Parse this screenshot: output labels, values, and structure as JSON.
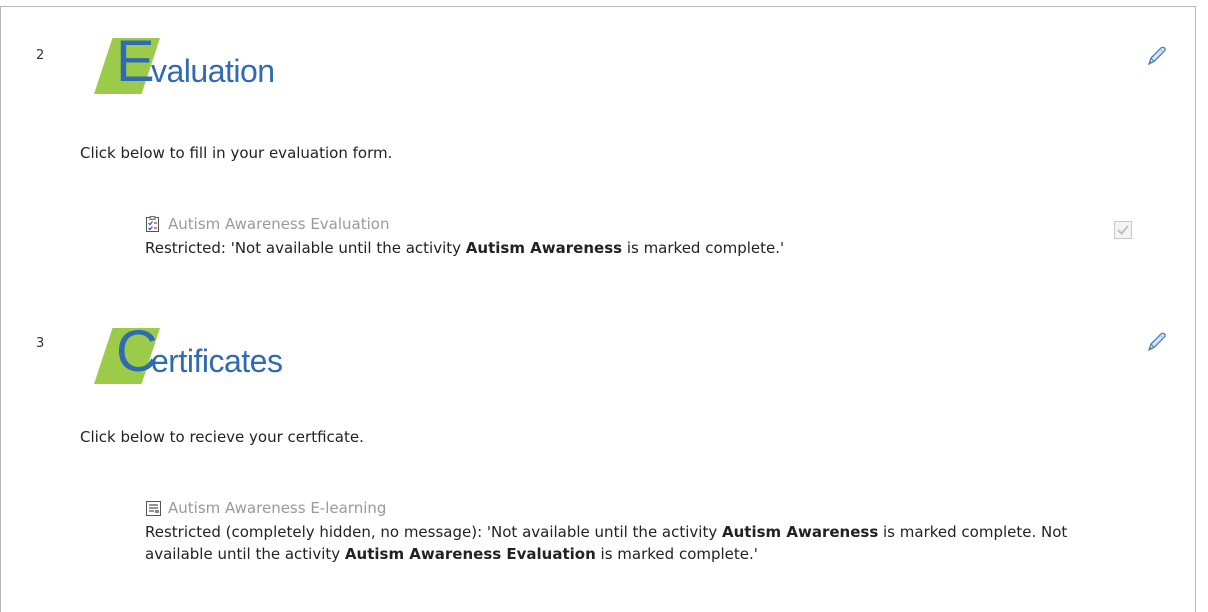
{
  "sections": [
    {
      "number": "2",
      "banner_initial": "E",
      "banner_rest": "valuation",
      "summary": "Click below to fill in your evaluation form.",
      "activity": {
        "name": "Autism Awareness Evaluation",
        "icon": "feedback-icon",
        "restriction": {
          "prefix": "Restricted: 'Not available until the activity ",
          "bold1": "Autism Awareness",
          "suffix": " is marked complete.'"
        },
        "completion_checked": true
      }
    },
    {
      "number": "3",
      "banner_initial": "C",
      "banner_rest": "ertificates",
      "summary": "Click below to recieve your certficate.",
      "activity": {
        "name": "Autism Awareness E-learning",
        "icon": "scorm-package-icon",
        "restriction": {
          "prefix": "Restricted (completely hidden, no message): 'Not available until the activity ",
          "bold1": "Autism Awareness",
          "middle": " is marked complete. Not available until the activity ",
          "bold2": "Autism Awareness Evaluation",
          "suffix": " is marked complete.'"
        }
      }
    }
  ],
  "colors": {
    "banner_green": "#9ccb4a",
    "banner_blue": "#2f6ab3",
    "dimmed_link": "#9a9a9a"
  }
}
